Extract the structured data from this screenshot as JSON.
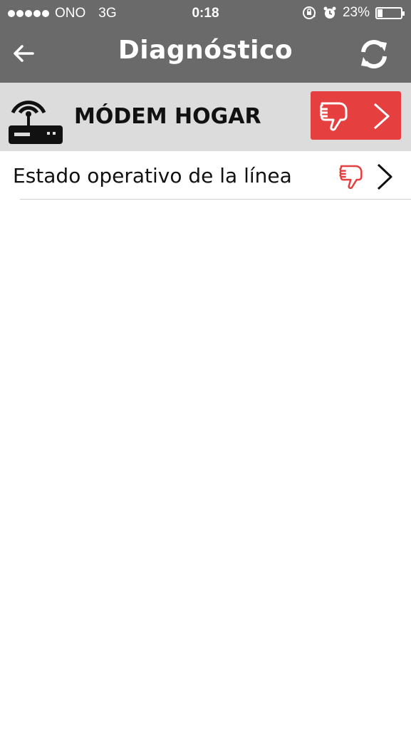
{
  "status_bar": {
    "carrier": "ONO",
    "network": "3G",
    "time": "0:18",
    "battery_percent": "23%",
    "battery_level": 0.23,
    "icons": [
      "signal-dots-icon",
      "rotation-lock-icon",
      "alarm-icon",
      "battery-icon"
    ]
  },
  "nav": {
    "title": "Diagnóstico",
    "back_icon": "back-arrow-icon",
    "refresh_icon": "refresh-icon"
  },
  "section": {
    "label": "MÓDEM HOGAR",
    "icon": "modem-icon",
    "status_icon": "thumbs-down-icon",
    "status_color": "#e53f3f"
  },
  "rows": [
    {
      "label": "Estado operativo de la línea",
      "status_icon": "thumbs-down-icon",
      "status_color": "#e53f3f"
    }
  ],
  "colors": {
    "header_bg": "#6a6a6a",
    "section_bg": "#dcdcdc",
    "error_red": "#e53f3f"
  }
}
